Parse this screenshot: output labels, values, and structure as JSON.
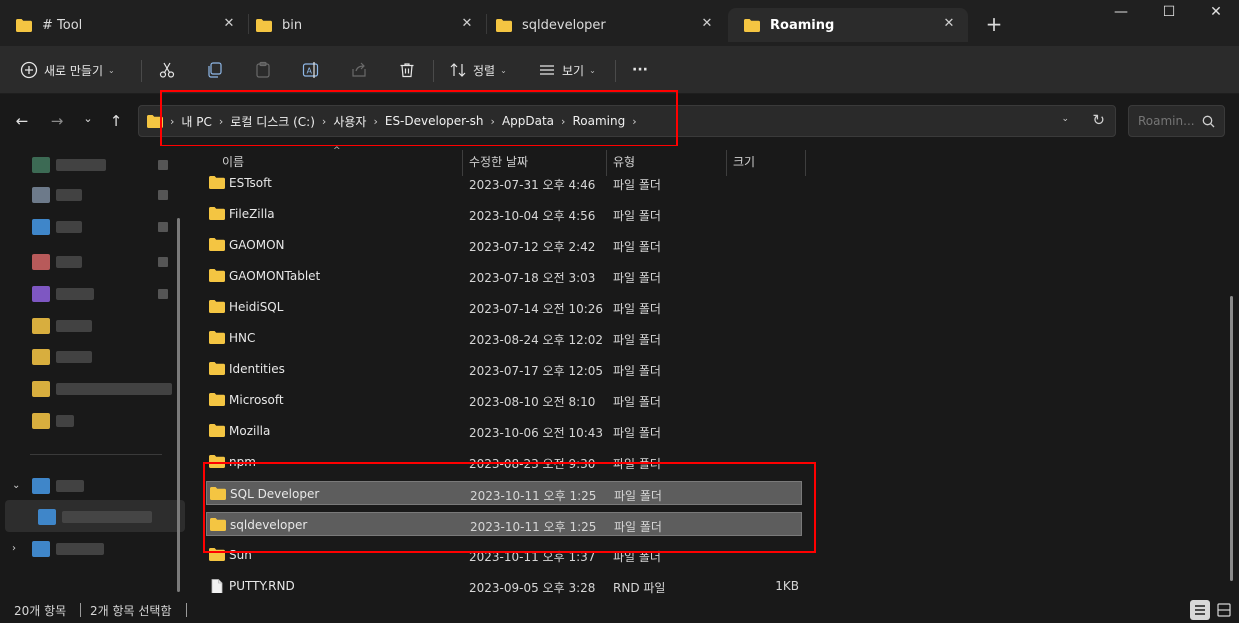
{
  "tabs": [
    {
      "label": "# Tool",
      "close": "✕"
    },
    {
      "label": "bin",
      "close": "✕"
    },
    {
      "label": "sqldeveloper",
      "close": "✕"
    },
    {
      "label": "Roaming",
      "close": "✕"
    }
  ],
  "tabbar": {
    "new_tab": "+"
  },
  "window": {
    "minimize": "—",
    "maximize": "☐",
    "close": "✕"
  },
  "toolbar": {
    "new_label": "새로 만들기",
    "sort_label": "정렬",
    "view_label": "보기",
    "more_label": "···",
    "chevron": "⌄"
  },
  "nav": {
    "back": "←",
    "forward": "→",
    "recent": "⌄",
    "up": "↑"
  },
  "address": {
    "breadcrumbs": [
      "내 PC",
      "로컬 디스크 (C:)",
      "사용자",
      "ES-Developer-sh",
      "AppData",
      "Roaming"
    ],
    "separator": "›",
    "dropdown": "⌄",
    "refresh": "↻"
  },
  "search": {
    "placeholder": "Roamin..."
  },
  "columns": {
    "name": "이름",
    "modified": "수정한 날짜",
    "type": "유형",
    "size": "크기",
    "sort_indicator": "^"
  },
  "files": [
    {
      "name": "ESTsoft",
      "date": "2023-07-31 오후 4:46",
      "type": "파일 폴더",
      "size": "",
      "kind": "folder",
      "selected": false
    },
    {
      "name": "FileZilla",
      "date": "2023-10-04 오후 4:56",
      "type": "파일 폴더",
      "size": "",
      "kind": "folder",
      "selected": false
    },
    {
      "name": "GAOMON",
      "date": "2023-07-12 오후 2:42",
      "type": "파일 폴더",
      "size": "",
      "kind": "folder",
      "selected": false
    },
    {
      "name": "GAOMONTablet",
      "date": "2023-07-18 오전 3:03",
      "type": "파일 폴더",
      "size": "",
      "kind": "folder",
      "selected": false
    },
    {
      "name": "HeidiSQL",
      "date": "2023-07-14 오전 10:26",
      "type": "파일 폴더",
      "size": "",
      "kind": "folder",
      "selected": false
    },
    {
      "name": "HNC",
      "date": "2023-08-24 오후 12:02",
      "type": "파일 폴더",
      "size": "",
      "kind": "folder",
      "selected": false
    },
    {
      "name": "Identities",
      "date": "2023-07-17 오후 12:05",
      "type": "파일 폴더",
      "size": "",
      "kind": "folder",
      "selected": false
    },
    {
      "name": "Microsoft",
      "date": "2023-08-10 오전 8:10",
      "type": "파일 폴더",
      "size": "",
      "kind": "folder",
      "selected": false
    },
    {
      "name": "Mozilla",
      "date": "2023-10-06 오전 10:43",
      "type": "파일 폴더",
      "size": "",
      "kind": "folder",
      "selected": false
    },
    {
      "name": "npm",
      "date": "2023-08-23 오전 9:30",
      "type": "파일 폴더",
      "size": "",
      "kind": "folder",
      "selected": false
    },
    {
      "name": "SQL Developer",
      "date": "2023-10-11 오후 1:25",
      "type": "파일 폴더",
      "size": "",
      "kind": "folder",
      "selected": true
    },
    {
      "name": "sqldeveloper",
      "date": "2023-10-11 오후 1:25",
      "type": "파일 폴더",
      "size": "",
      "kind": "folder",
      "selected": true
    },
    {
      "name": "Sun",
      "date": "2023-10-11 오후 1:37",
      "type": "파일 폴더",
      "size": "",
      "kind": "folder",
      "selected": false
    },
    {
      "name": "PUTTY.RND",
      "date": "2023-09-05 오후 3:28",
      "type": "RND 파일",
      "size": "1KB",
      "kind": "file",
      "selected": false
    }
  ],
  "status": {
    "item_count": "20개 항목",
    "selected_count": "2개 항목 선택함"
  },
  "colors": {
    "folder": "#f4c542",
    "highlight": "#ff0000",
    "selection": "#5d5d5d"
  }
}
